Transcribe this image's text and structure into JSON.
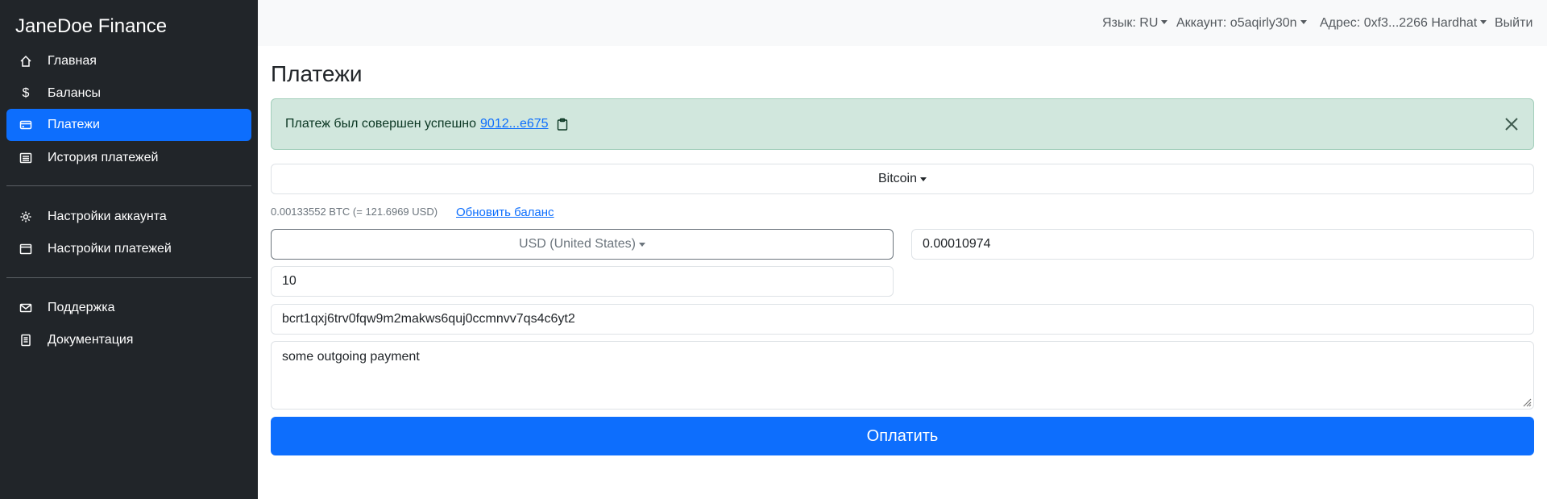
{
  "app": {
    "brand": "JaneDoe Finance"
  },
  "sidebar": {
    "items": [
      {
        "label": "Главная",
        "icon": "home-icon"
      },
      {
        "label": "Балансы",
        "icon": "dollar-icon"
      },
      {
        "label": "Платежи",
        "icon": "card-icon",
        "active": true
      },
      {
        "label": "История платежей",
        "icon": "list-icon"
      },
      {
        "label": "Настройки аккаунта",
        "icon": "gear-icon"
      },
      {
        "label": "Настройки платежей",
        "icon": "window-icon"
      },
      {
        "label": "Поддержка",
        "icon": "envelope-icon"
      },
      {
        "label": "Документация",
        "icon": "document-icon"
      }
    ]
  },
  "topbar": {
    "language": "Язык: RU",
    "account": "Аккаунт: o5aqirly30n",
    "address": "Адрес: 0xf3...2266 Hardhat",
    "logout": "Выйти"
  },
  "main": {
    "title": "Платежи",
    "alert": {
      "text": "Платеж был совершен успешно",
      "link": "9012...e675"
    },
    "currency_select": "Bitcoin",
    "balance_text": "0.00133552 BTC (= 121.6969 USD)",
    "refresh_link": "Обновить баланс",
    "fiat_select": "USD (United States)",
    "crypto_amount": "0.00010974",
    "fiat_amount": "10",
    "address": "bcrt1qxj6trv0fqw9m2makws6quj0ccmnvv7qs4c6yt2",
    "comment": "some outgoing payment",
    "pay_button": "Оплатить"
  },
  "colors": {
    "sidebar_bg": "#212529",
    "accent": "#0d6efd",
    "alert_bg": "#d1e7dd",
    "topbar_bg": "#f8f9fa"
  }
}
